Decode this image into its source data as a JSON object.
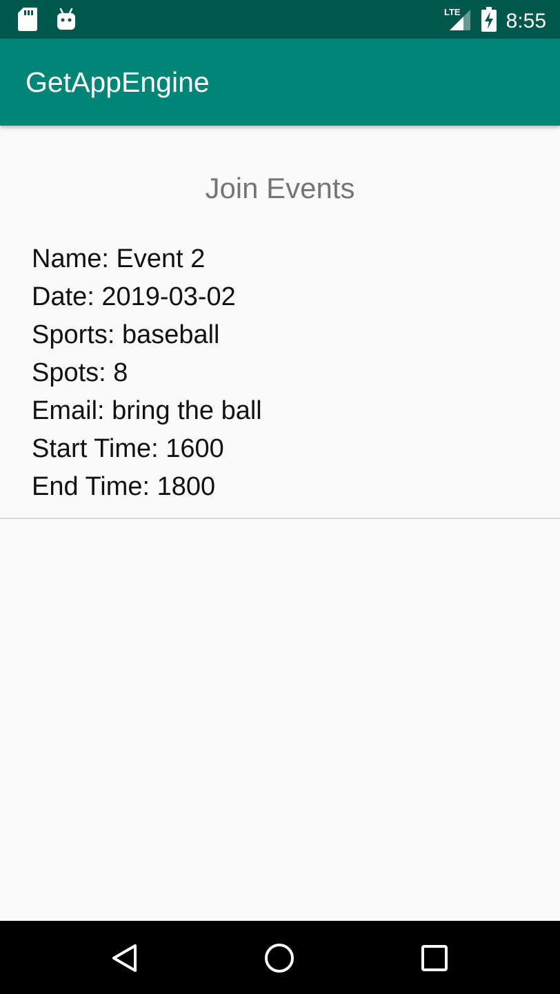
{
  "status_bar": {
    "time": "8:55",
    "network_label": "LTE",
    "icons": [
      "sd-card-icon",
      "android-icon",
      "lte-signal-icon",
      "battery-charging-icon"
    ]
  },
  "app_bar": {
    "title": "GetAppEngine"
  },
  "page": {
    "title": "Join Events"
  },
  "events": [
    {
      "lines": [
        "Name: Event 2",
        "Date: 2019-03-02",
        "Sports: baseball",
        "Spots: 8",
        "Email: bring the ball",
        "Start Time: 1600",
        "End Time: 1800"
      ]
    }
  ],
  "nav_bar": {
    "icons": [
      "back-icon",
      "home-icon",
      "recents-icon"
    ]
  },
  "colors": {
    "status_bar": "#00574b",
    "app_bar": "#008577",
    "background": "#fafafa",
    "page_title": "#757575",
    "event_text": "#111111",
    "divider": "#d9d9d9"
  }
}
